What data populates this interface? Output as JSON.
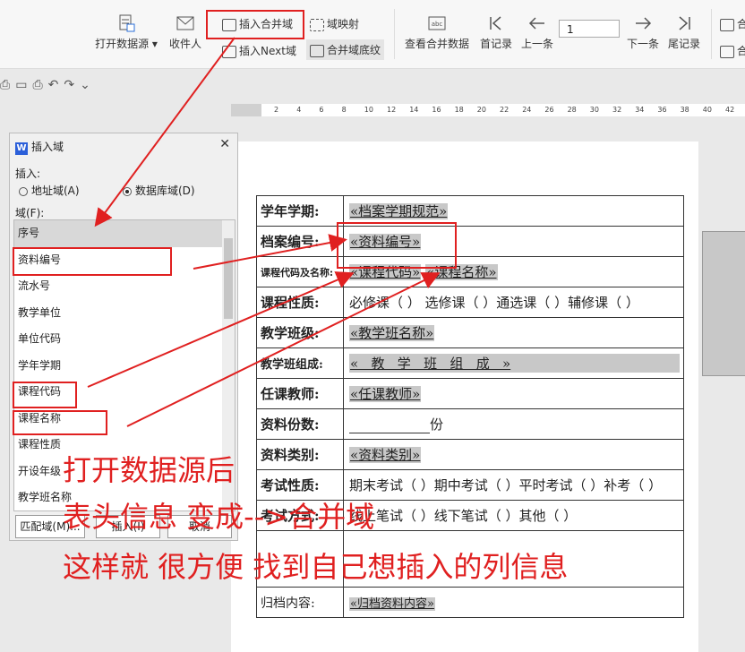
{
  "ribbon": {
    "open_datasource": "打开数据源",
    "recipient": "收件人",
    "insert_merge_field": "插入合并域",
    "field_map": "域映射",
    "insert_next_field": "插入Next域",
    "merge_field_shading": "合并域底纹",
    "view_merge_data": "查看合并数据",
    "first_record": "首记录",
    "prev": "上一条",
    "record_number": "1",
    "next": "下一条",
    "last_record": "尾记录",
    "merge_a": "合",
    "merge_b": "合"
  },
  "ruler_ticks": [
    "2",
    "4",
    "6",
    "8",
    "10",
    "12",
    "14",
    "16",
    "18",
    "20",
    "22",
    "24",
    "26",
    "28",
    "30",
    "32",
    "34",
    "36",
    "38",
    "40",
    "42"
  ],
  "dialog": {
    "title": "插入域",
    "insert_label": "插入:",
    "radio_address": "地址域(A)",
    "radio_database": "数据库域(D)",
    "field_label": "域(F):",
    "items": [
      "序号",
      "资料编号",
      "流水号",
      "教学单位",
      "单位代码",
      "学年学期",
      "课程代码",
      "课程名称",
      "课程性质",
      "开设年级",
      "教学班名称"
    ],
    "match_button": "匹配域(M)...",
    "insert_button": "插入(I)",
    "cancel_button": "取消"
  },
  "form": {
    "rows": [
      {
        "label": "学年学期:",
        "value": "«档案学期规范»"
      },
      {
        "label": "档案编号:",
        "value": "«资料编号»"
      },
      {
        "label": "课程代码及名称:",
        "value": "«课程代码»",
        "value2": "«课程名称»"
      },
      {
        "label": "课程性质:",
        "value": "必修课（  ） 选修课（  ）通选课（  ）辅修课（  ）"
      },
      {
        "label": "教学班级:",
        "value": "«教学班名称»"
      },
      {
        "label": "教学班组成:",
        "value": "«   教   学   班   组   成   »"
      },
      {
        "label": "任课教师:",
        "value": "«任课教师»"
      },
      {
        "label": "资料份数:",
        "value": "份"
      },
      {
        "label": "资料类别:",
        "value": "«资料类别»"
      },
      {
        "label": "考试性质:",
        "value": "期末考试（  ）期中考试（  ）平时考试（  ）补考（  ）"
      },
      {
        "label": "考试方式:",
        "value": "线上笔试（  ）线下笔试（  ）其他（  ）"
      },
      {
        "label": "",
        "value": ""
      },
      {
        "label": "归档内容:",
        "value": "«归档资料内容»"
      }
    ]
  },
  "annotations": {
    "line1": "打开数据源后",
    "line2": "表头信息 变成-->合并域",
    "line3": "这样就 很方便 找到自己想插入的列信息"
  },
  "colors": {
    "annotation": "#e02020",
    "merge_field_bg": "#c8c8c8",
    "logo": "#2b5fd9"
  }
}
